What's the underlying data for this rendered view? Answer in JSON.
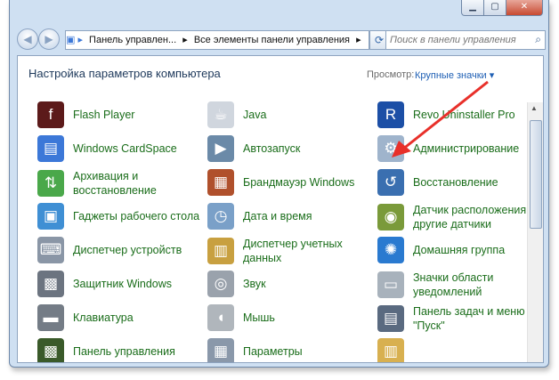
{
  "window": {
    "min_label": "▁",
    "max_label": "▢",
    "close_label": "✕"
  },
  "nav": {
    "back": "◀",
    "forward": "▶",
    "address": [
      "Панель управлен...",
      "Все элементы панели управления",
      "▸"
    ],
    "refresh": "⟳",
    "search_placeholder": "Поиск в панели управления",
    "search_icon": "⌕"
  },
  "header": {
    "title": "Настройка параметров компьютера",
    "view_label": "Просмотр:",
    "view_value": "Крупные значки ▾"
  },
  "items": [
    {
      "label": "Flash Player",
      "icon": "flash-icon",
      "color": "#5c1a1a",
      "glyph": "f"
    },
    {
      "label": "Java",
      "icon": "java-icon",
      "color": "#d0d6de",
      "glyph": "☕"
    },
    {
      "label": "Revo Uninstaller Pro",
      "icon": "revo-icon",
      "color": "#1c4fa6",
      "glyph": "R"
    },
    {
      "label": "Windows CardSpace",
      "icon": "cardspace-icon",
      "color": "#3c78d8",
      "glyph": "▤"
    },
    {
      "label": "Автозапуск",
      "icon": "autoplay-icon",
      "color": "#6b8aa8",
      "glyph": "▶"
    },
    {
      "label": "Администрирование",
      "icon": "admin-tools-icon",
      "color": "#9fb4cc",
      "glyph": "⚙"
    },
    {
      "label": "Архивация и\nвосстановление",
      "icon": "backup-icon",
      "color": "#4aa84a",
      "glyph": "⇅"
    },
    {
      "label": "Брандмауэр Windows",
      "icon": "firewall-icon",
      "color": "#b0502c",
      "glyph": "▦"
    },
    {
      "label": "Восстановление",
      "icon": "recovery-icon",
      "color": "#3a6fb0",
      "glyph": "↺"
    },
    {
      "label": "Гаджеты рабочего стола",
      "icon": "gadgets-icon",
      "color": "#3f8fd4",
      "glyph": "▣"
    },
    {
      "label": "Дата и время",
      "icon": "datetime-icon",
      "color": "#7aa0c8",
      "glyph": "◷"
    },
    {
      "label": "Датчик расположения и\nдругие датчики",
      "icon": "sensor-icon",
      "color": "#7a9a3a",
      "glyph": "◉"
    },
    {
      "label": "Диспетчер устройств",
      "icon": "device-manager-icon",
      "color": "#8a96a6",
      "glyph": "⌨"
    },
    {
      "label": "Диспетчер учетных\nданных",
      "icon": "credential-icon",
      "color": "#c8a040",
      "glyph": "▥"
    },
    {
      "label": "Домашняя группа",
      "icon": "homegroup-icon",
      "color": "#2a7ad0",
      "glyph": "✺"
    },
    {
      "label": "Защитник Windows",
      "icon": "defender-icon",
      "color": "#6c7480",
      "glyph": "▩"
    },
    {
      "label": "Звук",
      "icon": "sound-icon",
      "color": "#9aa2ac",
      "glyph": "◎"
    },
    {
      "label": "Значки области\nуведомлений",
      "icon": "tray-icons-icon",
      "color": "#a8b2bc",
      "glyph": "▭"
    },
    {
      "label": "Клавиатура",
      "icon": "keyboard-icon",
      "color": "#747c86",
      "glyph": "▬"
    },
    {
      "label": "Мышь",
      "icon": "mouse-icon",
      "color": "#b0b6bc",
      "glyph": "◖"
    },
    {
      "label": "Панель задач и меню\n\"Пуск\"",
      "icon": "taskbar-icon",
      "color": "#5a6a80",
      "glyph": "▤"
    },
    {
      "label": "Панель управления",
      "icon": "control-panel-icon",
      "color": "#3a5a2a",
      "glyph": "▩"
    },
    {
      "label": "Параметры",
      "icon": "options-icon",
      "color": "#8a98aa",
      "glyph": "▦"
    },
    {
      "label": "",
      "icon": "folder-icon",
      "color": "#d8b050",
      "glyph": "▥"
    }
  ],
  "annotation": {
    "arrow_color": "#e8302a"
  }
}
